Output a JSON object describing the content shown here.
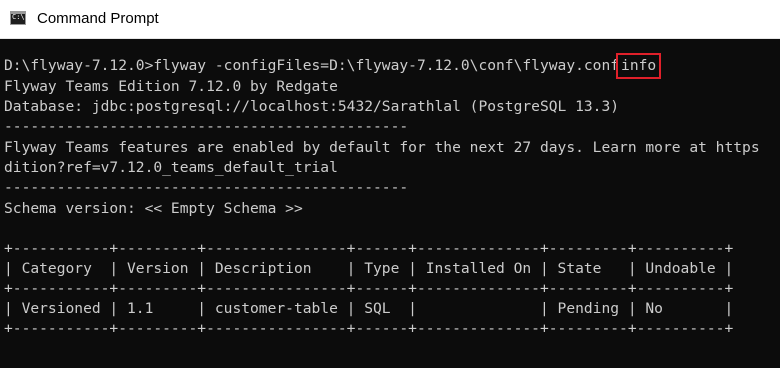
{
  "window": {
    "title": "Command Prompt",
    "icon": "cmd-icon",
    "icon_text": "C:\\"
  },
  "console": {
    "command_prompt": "D:\\flyway-7.12.0>flyway -configFiles=D:\\flyway-7.12.0\\conf\\flyway.conf",
    "command_arg": "info",
    "highlight_color": "#e0202a",
    "edition_line": "Flyway Teams Edition 7.12.0 by Redgate",
    "database_line": "Database: jdbc:postgresql://localhost:5432/Sarathlal (PostgreSQL 13.3)",
    "separator_line": "----------------------------------------------",
    "trial_line_1": "Flyway Teams features are enabled by default for the next 27 days. Learn more at https",
    "trial_line_2": "dition?ref=v7.12.0_teams_default_trial",
    "separator_line_2": "----------------------------------------------",
    "schema_line": "Schema version: << Empty Schema >>",
    "table": {
      "border_top": "+-----------+---------+----------------+------+--------------+---------+----------+",
      "header_row": "| Category  | Version | Description    | Type | Installed On | State   | Undoable |",
      "border_mid": "+-----------+---------+----------------+------+--------------+---------+----------+",
      "data_row": "| Versioned | 1.1     | customer-table | SQL  |              | Pending | No       |",
      "border_bottom": "+-----------+---------+----------------+------+--------------+---------+----------+",
      "columns": [
        "Category",
        "Version",
        "Description",
        "Type",
        "Installed On",
        "State",
        "Undoable"
      ],
      "rows": [
        [
          "Versioned",
          "1.1",
          "customer-table",
          "SQL",
          "",
          "Pending",
          "No"
        ]
      ]
    }
  }
}
